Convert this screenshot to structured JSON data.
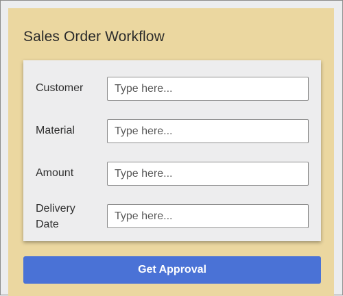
{
  "workflow": {
    "title": "Sales Order Workflow"
  },
  "form": {
    "fields": [
      {
        "label": "Customer",
        "placeholder": "Type here...",
        "value": ""
      },
      {
        "label": "Material",
        "placeholder": "Type here...",
        "value": ""
      },
      {
        "label": "Amount",
        "placeholder": "Type here...",
        "value": ""
      },
      {
        "label": "Delivery Date",
        "placeholder": "Type here...",
        "value": ""
      }
    ]
  },
  "actions": {
    "submit_label": "Get Approval"
  },
  "colors": {
    "panel_bg": "#ebd7a0",
    "card_bg": "#ededee",
    "primary_button": "#4a72d6"
  }
}
